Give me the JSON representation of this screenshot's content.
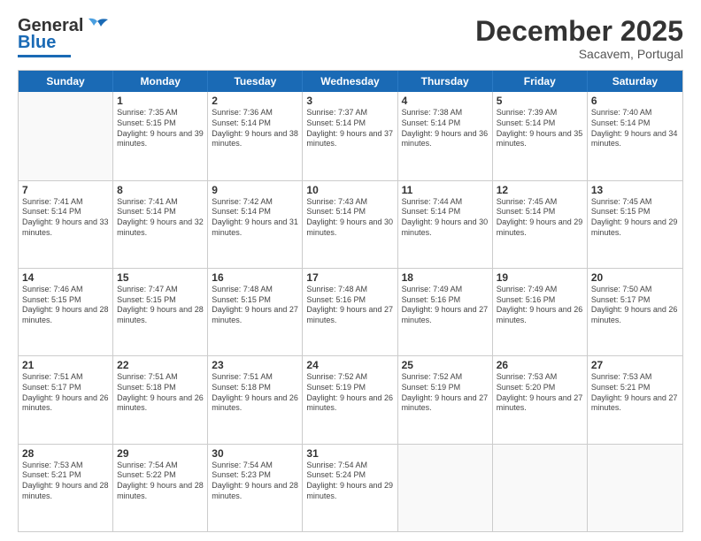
{
  "header": {
    "logo_general": "General",
    "logo_blue": "Blue",
    "month_title": "December 2025",
    "subtitle": "Sacavem, Portugal"
  },
  "weekdays": [
    "Sunday",
    "Monday",
    "Tuesday",
    "Wednesday",
    "Thursday",
    "Friday",
    "Saturday"
  ],
  "rows": [
    [
      {
        "day": "",
        "empty": true
      },
      {
        "day": "1",
        "sunrise": "Sunrise: 7:35 AM",
        "sunset": "Sunset: 5:15 PM",
        "daylight": "Daylight: 9 hours and 39 minutes."
      },
      {
        "day": "2",
        "sunrise": "Sunrise: 7:36 AM",
        "sunset": "Sunset: 5:14 PM",
        "daylight": "Daylight: 9 hours and 38 minutes."
      },
      {
        "day": "3",
        "sunrise": "Sunrise: 7:37 AM",
        "sunset": "Sunset: 5:14 PM",
        "daylight": "Daylight: 9 hours and 37 minutes."
      },
      {
        "day": "4",
        "sunrise": "Sunrise: 7:38 AM",
        "sunset": "Sunset: 5:14 PM",
        "daylight": "Daylight: 9 hours and 36 minutes."
      },
      {
        "day": "5",
        "sunrise": "Sunrise: 7:39 AM",
        "sunset": "Sunset: 5:14 PM",
        "daylight": "Daylight: 9 hours and 35 minutes."
      },
      {
        "day": "6",
        "sunrise": "Sunrise: 7:40 AM",
        "sunset": "Sunset: 5:14 PM",
        "daylight": "Daylight: 9 hours and 34 minutes."
      }
    ],
    [
      {
        "day": "7",
        "sunrise": "Sunrise: 7:41 AM",
        "sunset": "Sunset: 5:14 PM",
        "daylight": "Daylight: 9 hours and 33 minutes."
      },
      {
        "day": "8",
        "sunrise": "Sunrise: 7:41 AM",
        "sunset": "Sunset: 5:14 PM",
        "daylight": "Daylight: 9 hours and 32 minutes."
      },
      {
        "day": "9",
        "sunrise": "Sunrise: 7:42 AM",
        "sunset": "Sunset: 5:14 PM",
        "daylight": "Daylight: 9 hours and 31 minutes."
      },
      {
        "day": "10",
        "sunrise": "Sunrise: 7:43 AM",
        "sunset": "Sunset: 5:14 PM",
        "daylight": "Daylight: 9 hours and 30 minutes."
      },
      {
        "day": "11",
        "sunrise": "Sunrise: 7:44 AM",
        "sunset": "Sunset: 5:14 PM",
        "daylight": "Daylight: 9 hours and 30 minutes."
      },
      {
        "day": "12",
        "sunrise": "Sunrise: 7:45 AM",
        "sunset": "Sunset: 5:14 PM",
        "daylight": "Daylight: 9 hours and 29 minutes."
      },
      {
        "day": "13",
        "sunrise": "Sunrise: 7:45 AM",
        "sunset": "Sunset: 5:15 PM",
        "daylight": "Daylight: 9 hours and 29 minutes."
      }
    ],
    [
      {
        "day": "14",
        "sunrise": "Sunrise: 7:46 AM",
        "sunset": "Sunset: 5:15 PM",
        "daylight": "Daylight: 9 hours and 28 minutes."
      },
      {
        "day": "15",
        "sunrise": "Sunrise: 7:47 AM",
        "sunset": "Sunset: 5:15 PM",
        "daylight": "Daylight: 9 hours and 28 minutes."
      },
      {
        "day": "16",
        "sunrise": "Sunrise: 7:48 AM",
        "sunset": "Sunset: 5:15 PM",
        "daylight": "Daylight: 9 hours and 27 minutes."
      },
      {
        "day": "17",
        "sunrise": "Sunrise: 7:48 AM",
        "sunset": "Sunset: 5:16 PM",
        "daylight": "Daylight: 9 hours and 27 minutes."
      },
      {
        "day": "18",
        "sunrise": "Sunrise: 7:49 AM",
        "sunset": "Sunset: 5:16 PM",
        "daylight": "Daylight: 9 hours and 27 minutes."
      },
      {
        "day": "19",
        "sunrise": "Sunrise: 7:49 AM",
        "sunset": "Sunset: 5:16 PM",
        "daylight": "Daylight: 9 hours and 26 minutes."
      },
      {
        "day": "20",
        "sunrise": "Sunrise: 7:50 AM",
        "sunset": "Sunset: 5:17 PM",
        "daylight": "Daylight: 9 hours and 26 minutes."
      }
    ],
    [
      {
        "day": "21",
        "sunrise": "Sunrise: 7:51 AM",
        "sunset": "Sunset: 5:17 PM",
        "daylight": "Daylight: 9 hours and 26 minutes."
      },
      {
        "day": "22",
        "sunrise": "Sunrise: 7:51 AM",
        "sunset": "Sunset: 5:18 PM",
        "daylight": "Daylight: 9 hours and 26 minutes."
      },
      {
        "day": "23",
        "sunrise": "Sunrise: 7:51 AM",
        "sunset": "Sunset: 5:18 PM",
        "daylight": "Daylight: 9 hours and 26 minutes."
      },
      {
        "day": "24",
        "sunrise": "Sunrise: 7:52 AM",
        "sunset": "Sunset: 5:19 PM",
        "daylight": "Daylight: 9 hours and 26 minutes."
      },
      {
        "day": "25",
        "sunrise": "Sunrise: 7:52 AM",
        "sunset": "Sunset: 5:19 PM",
        "daylight": "Daylight: 9 hours and 27 minutes."
      },
      {
        "day": "26",
        "sunrise": "Sunrise: 7:53 AM",
        "sunset": "Sunset: 5:20 PM",
        "daylight": "Daylight: 9 hours and 27 minutes."
      },
      {
        "day": "27",
        "sunrise": "Sunrise: 7:53 AM",
        "sunset": "Sunset: 5:21 PM",
        "daylight": "Daylight: 9 hours and 27 minutes."
      }
    ],
    [
      {
        "day": "28",
        "sunrise": "Sunrise: 7:53 AM",
        "sunset": "Sunset: 5:21 PM",
        "daylight": "Daylight: 9 hours and 28 minutes."
      },
      {
        "day": "29",
        "sunrise": "Sunrise: 7:54 AM",
        "sunset": "Sunset: 5:22 PM",
        "daylight": "Daylight: 9 hours and 28 minutes."
      },
      {
        "day": "30",
        "sunrise": "Sunrise: 7:54 AM",
        "sunset": "Sunset: 5:23 PM",
        "daylight": "Daylight: 9 hours and 28 minutes."
      },
      {
        "day": "31",
        "sunrise": "Sunrise: 7:54 AM",
        "sunset": "Sunset: 5:24 PM",
        "daylight": "Daylight: 9 hours and 29 minutes."
      },
      {
        "day": "",
        "empty": true
      },
      {
        "day": "",
        "empty": true
      },
      {
        "day": "",
        "empty": true
      }
    ]
  ]
}
